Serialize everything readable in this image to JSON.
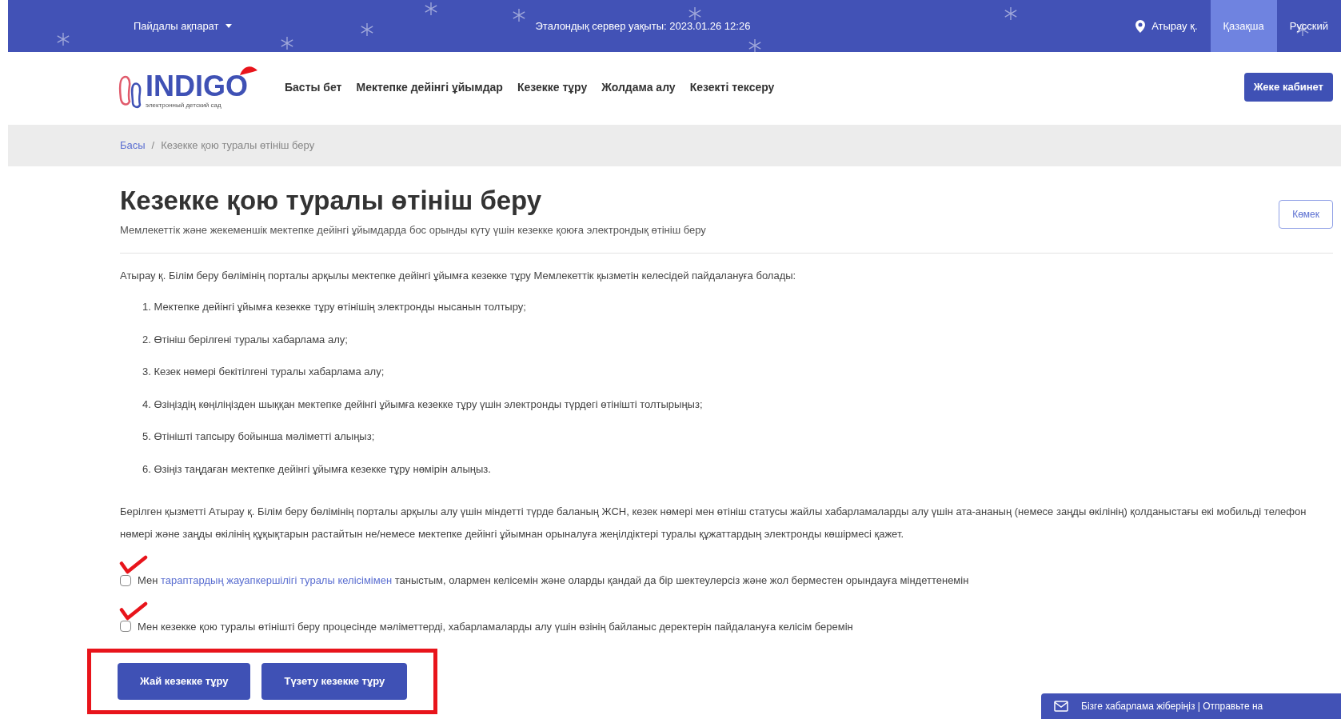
{
  "top_bar": {
    "info_menu": "Пайдалы ақпарат",
    "server_time": "Эталондық сервер уақыты: 2023.01.26 12:26",
    "city": "Атырау қ.",
    "languages": [
      {
        "label": "Қазақша",
        "selected": true
      },
      {
        "label": "Русский",
        "selected": false
      }
    ]
  },
  "header": {
    "logo": {
      "name": "INDIGO",
      "tagline": "электронный детский сад"
    },
    "nav": [
      "Басты бет",
      "Мектепке дейінгі ұйымдар",
      "Кезекке тұру",
      "Жолдама алу",
      "Кезекті тексеру"
    ],
    "cabinet_button": "Жеке кабинет"
  },
  "breadcrumb": {
    "home": "Басы",
    "separator": "/",
    "current": "Кезекке қою туралы өтініш беру"
  },
  "page": {
    "title": "Кезекке қою туралы өтініш беру",
    "subtitle": "Мемлекеттік және жекеменшік мектепке дейінгі ұйымдарда бос орынды күту үшін кезекке қоюға электрондық өтініш беру",
    "help_button": "Көмек",
    "intro": "Атырау қ. Білім беру бөлімінің порталы арқылы мектепке дейінгі ұйымға кезекке тұру Мемлекеттік қызметін келесідей пайдалануға болады:",
    "steps": [
      "1. Мектепке дейінгі ұйымға кезекке тұру өтінішің электронды нысанын толтыру;",
      "2. Өтініш берілгені туралы хабарлама алу;",
      "3. Кезек нөмері бекітілгені туралы хабарлама алу;",
      "4. Өзіңіздің көңіліңізден шыққан мектепке дейінгі ұйымға кезекке тұру үшін электронды түрдегі өтінішті толтырыңыз;",
      "5. Өтінішті тапсыру бойынша мәліметті алыңыз;",
      "6. Өзіңіз таңдаған мектепке дейінгі ұйымға кезекке тұру нөмірін алыңыз."
    ],
    "requirements": "Берілген қызметті Атырау қ. Білім беру бөлімінің порталы арқылы алу үшін міндетті түрде баланың ЖСН, кезек нөмері мен өтініш статусы жайлы хабарламаларды алу үшін ата-ананың (немесе заңды өкілінің) қолданыстағы екі мобильді телефон нөмері және заңды өкілінің құқықтарын растайтын не/немесе мектепке дейінгі ұйымнан орыналуға жеңілдіктері туралы құжаттардың электронды көшірмесі қажет.",
    "agreements": [
      {
        "prefix": "Мен",
        "link": "тараптардың жауапкершілігі туралы келісімімен",
        "text": "таныстым, олармен келісемін және оларды қандай да бір шектеулерсіз және жол берместен орындауға міндеттенемін",
        "checked": false,
        "marked": true
      },
      {
        "text": "Мен кезекке қою туралы өтінішті беру процесінде мәліметтерді, хабарламаларды алу үшін өзінің байланыс деректерін пайдалануға келісім беремін",
        "checked": false,
        "marked": true
      }
    ],
    "buttons": [
      "Жай кезекке тұру",
      "Түзету кезекке тұру"
    ],
    "buttons_highlighted": true
  },
  "feedback_bar": "Бізге хабарлама жіберіңіз | Отправьте на"
}
